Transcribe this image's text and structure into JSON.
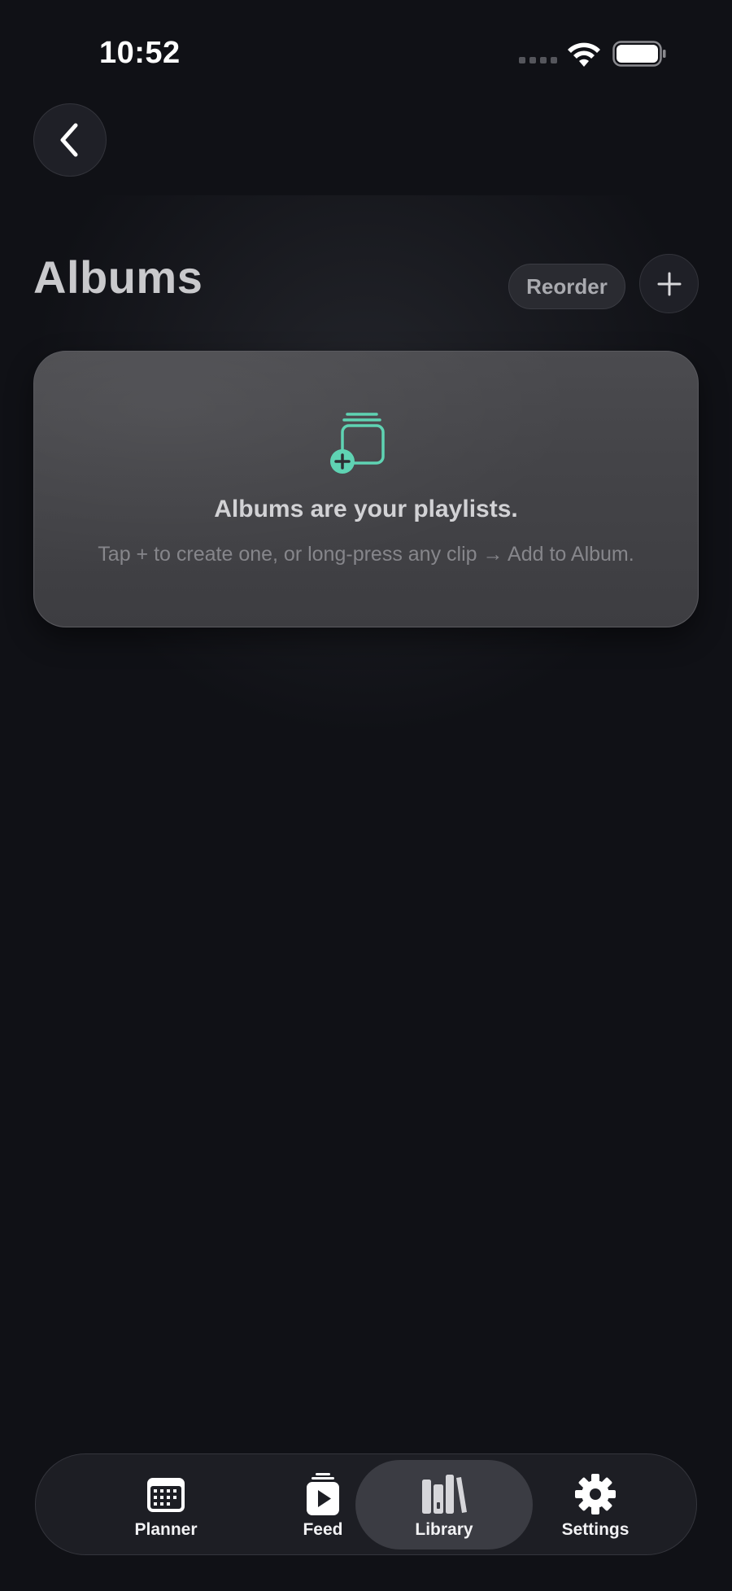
{
  "status_bar": {
    "time": "10:52",
    "icons": [
      "signal-icon",
      "wifi-icon",
      "battery-icon"
    ]
  },
  "nav": {
    "back_icon": "chevron-left-icon"
  },
  "header": {
    "title": "Albums",
    "reorder_label": "Reorder",
    "add_icon": "plus-icon"
  },
  "empty_state": {
    "icon": "add-album-icon",
    "title": "Albums are your playlists.",
    "subtitle": "Tap + to create one, or long-press any clip → Add to Album."
  },
  "tab_bar": {
    "tabs": [
      {
        "label": "Planner",
        "icon": "calendar-icon",
        "active": false
      },
      {
        "label": "Feed",
        "icon": "play-stack-icon",
        "active": false
      },
      {
        "label": "Library",
        "icon": "books-icon",
        "active": true
      },
      {
        "label": "Settings",
        "icon": "gear-icon",
        "active": false
      }
    ]
  },
  "colors": {
    "background": "#101116",
    "accent": "#5fd3b3",
    "card": "#46464a",
    "active_tab": "#3b3c43"
  }
}
